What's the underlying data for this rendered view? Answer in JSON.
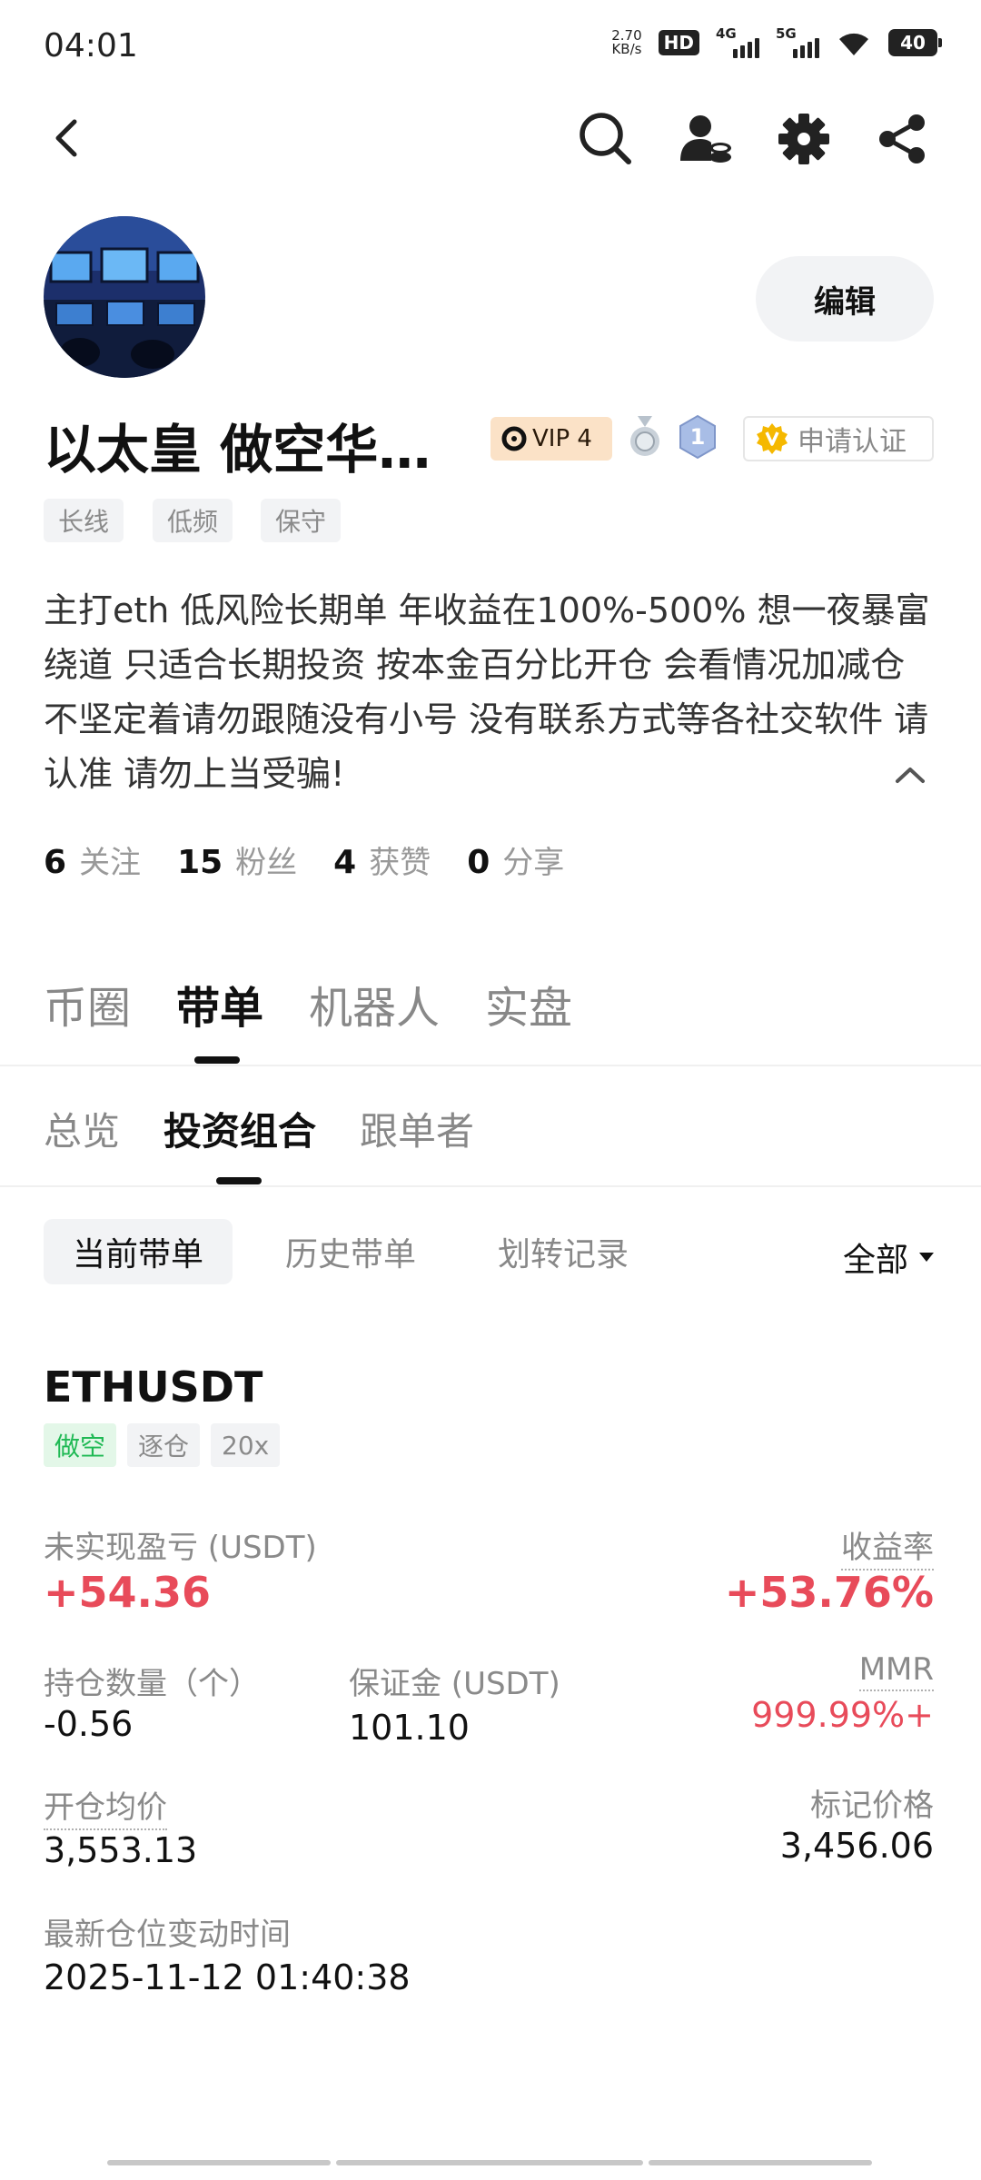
{
  "status_bar": {
    "time": "04:01",
    "net_speed_value": "2.70",
    "net_speed_unit": "KB/s",
    "hd_label": "HD",
    "sim1_label": "4G",
    "sim2_label": "5G",
    "battery": "40"
  },
  "nav": {
    "icons": [
      "back-icon",
      "search-icon",
      "user-coin-icon",
      "gear-icon",
      "share-icon"
    ]
  },
  "profile": {
    "edit_label": "编辑",
    "username": "以太皇 做空华…",
    "vip_label": "VIP 4",
    "medal_number": "1",
    "verify_label": "申请认证",
    "tags": [
      "长线",
      "低频",
      "保守"
    ],
    "bio": "主打eth 低风险长期单 年收益在100%-500% 想一夜暴富绕道 只适合长期投资 按本金百分比开仓 会看情况加减仓不坚定着请勿跟随没有小号 没有联系方式等各社交软件 请认准 请勿上当受骗!",
    "stats": [
      {
        "num": "6",
        "label": "关注"
      },
      {
        "num": "15",
        "label": "粉丝"
      },
      {
        "num": "4",
        "label": "获赞"
      },
      {
        "num": "0",
        "label": "分享"
      }
    ]
  },
  "main_tabs": [
    "币圈",
    "带单",
    "机器人",
    "实盘"
  ],
  "sub_tabs": [
    "总览",
    "投资组合",
    "跟单者"
  ],
  "filters": {
    "chips": [
      "当前带单",
      "历史带单",
      "划转记录"
    ],
    "all_label": "全部"
  },
  "position": {
    "symbol": "ETHUSDT",
    "tags": [
      "做空",
      "逐仓",
      "20x"
    ],
    "unrealized_pnl_label": "未实现盈亏 (USDT)",
    "unrealized_pnl": "+54.36",
    "roi_label": "收益率",
    "roi": "+53.76%",
    "qty_label": "持仓数量（个）",
    "qty": "-0.56",
    "margin_label": "保证金 (USDT)",
    "margin": "101.10",
    "mmr_label": "MMR",
    "mmr": "999.99%+",
    "entry_label": "开仓均价",
    "entry": "3,553.13",
    "mark_label": "标记价格",
    "mark": "3,456.06",
    "updated_label": "最新仓位变动时间",
    "updated": "2025-11-12 01:40:38"
  },
  "colors": {
    "profit_red": "#e84b5a",
    "short_green": "#1fb954",
    "vip_bg": "#fbe2c7",
    "verify_gold": "#f5b800"
  }
}
